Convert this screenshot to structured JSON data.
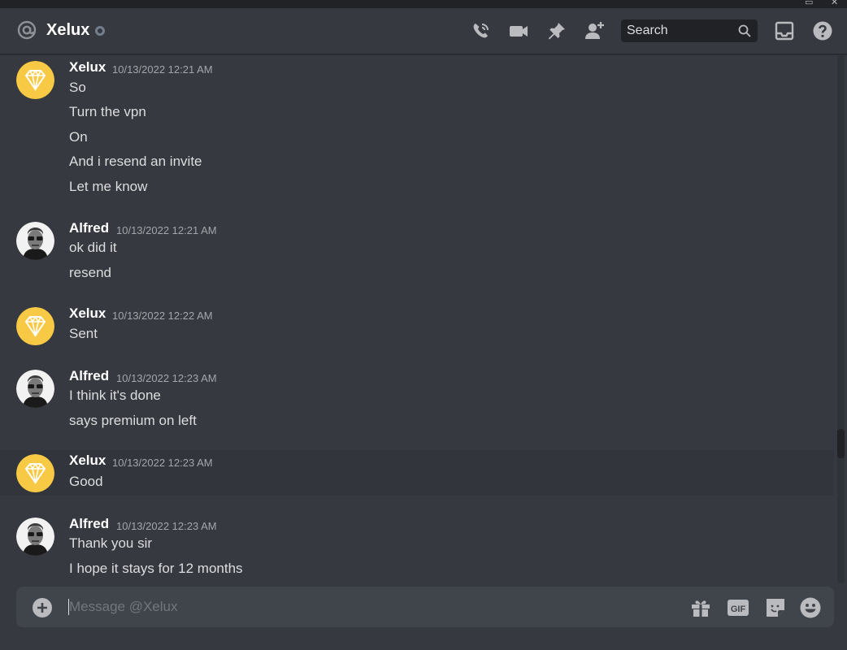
{
  "header": {
    "channel_name": "Xelux",
    "search_placeholder": "Search"
  },
  "messages": [
    {
      "author": "Xelux",
      "timestamp": "10/13/2022 12:21 AM",
      "avatar": "diamond-avatar",
      "lines": [
        "So",
        "Turn the vpn",
        "On",
        "And i resend an invite",
        "Let me know"
      ]
    },
    {
      "author": "Alfred",
      "timestamp": "10/13/2022 12:21 AM",
      "avatar": "portrait-avatar",
      "lines": [
        "ok did it",
        "resend"
      ]
    },
    {
      "author": "Xelux",
      "timestamp": "10/13/2022 12:22 AM",
      "avatar": "diamond-avatar",
      "lines": [
        "Sent"
      ]
    },
    {
      "author": "Alfred",
      "timestamp": "10/13/2022 12:23 AM",
      "avatar": "portrait-avatar",
      "lines": [
        "I think it's done",
        "says premium on left"
      ]
    },
    {
      "author": "Xelux",
      "timestamp": "10/13/2022 12:23 AM",
      "avatar": "diamond-avatar",
      "lines": [
        "Good"
      ]
    },
    {
      "author": "Alfred",
      "timestamp": "10/13/2022 12:23 AM",
      "avatar": "portrait-avatar",
      "lines": [
        "Thank you sir",
        "I hope it stays for 12 months"
      ]
    }
  ],
  "composer": {
    "placeholder": "Message @Xelux"
  },
  "icons": {
    "header": [
      "at-icon",
      "voice-call-icon",
      "video-call-icon",
      "pin-icon",
      "add-friend-icon",
      "search-icon",
      "inbox-icon",
      "help-icon"
    ],
    "composer": [
      "add-attachment-icon",
      "gift-icon",
      "gif-icon",
      "sticker-icon",
      "emoji-icon"
    ]
  },
  "colors": {
    "background": "#36393f",
    "diamond_avatar_bg": "#f7c944",
    "status_offline": "#747f8d",
    "input_bg": "#40444b"
  }
}
